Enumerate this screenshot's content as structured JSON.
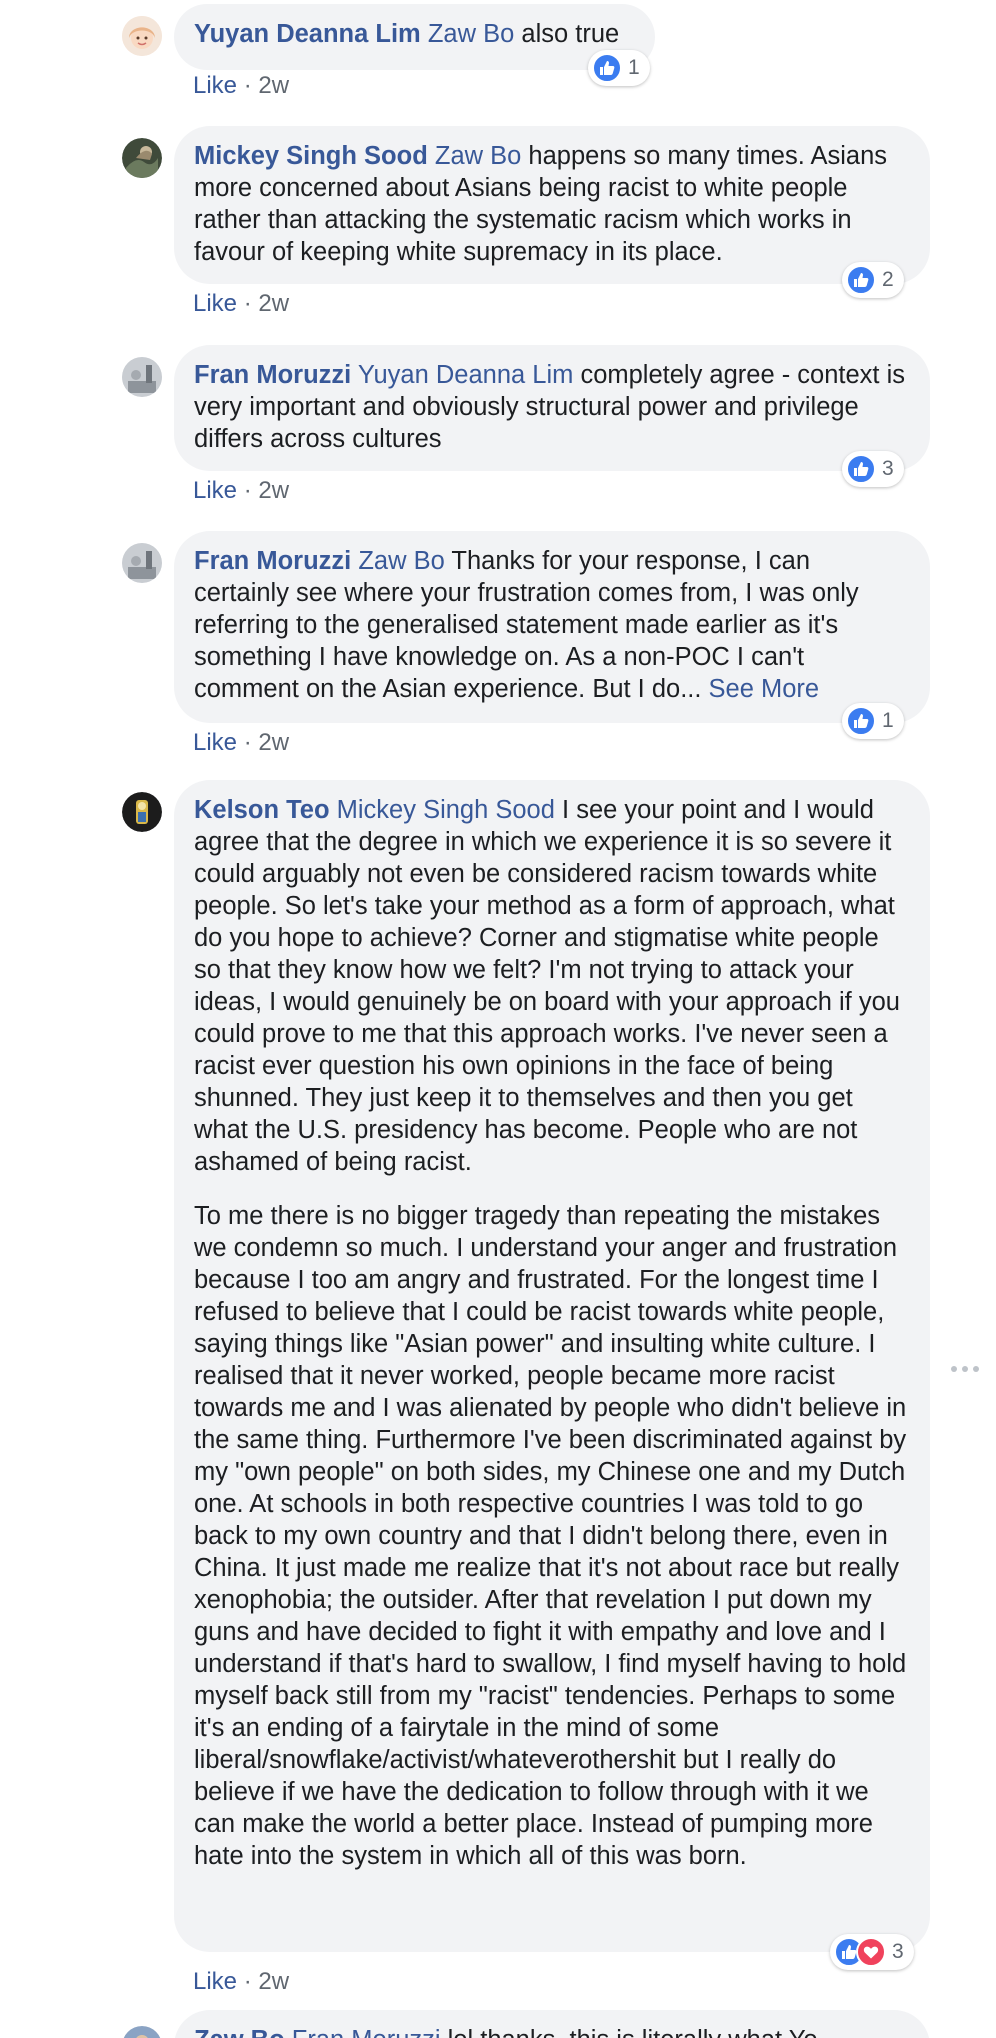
{
  "comments": [
    {
      "author": "Yuyan Deanna Lim",
      "mention": "Zaw Bo",
      "paragraphs": [
        " also true"
      ],
      "like_label": "Like",
      "sep": " · ",
      "time": "2w",
      "reaction_count": "1",
      "reactions": [
        "like"
      ]
    },
    {
      "author": "Mickey Singh Sood",
      "mention": "Zaw Bo",
      "paragraphs": [
        " happens so many times. Asians more concerned about Asians being racist to white people rather than attacking the systematic racism which works in favour of keeping white supremacy in its place."
      ],
      "like_label": "Like",
      "sep": " · ",
      "time": "2w",
      "reaction_count": "2",
      "reactions": [
        "like"
      ]
    },
    {
      "author": "Fran Moruzzi",
      "mention": "Yuyan Deanna Lim",
      "paragraphs": [
        " completely agree - context is very important and obviously structural power and privilege differs across cultures"
      ],
      "like_label": "Like",
      "sep": " · ",
      "time": "2w",
      "reaction_count": "3",
      "reactions": [
        "like"
      ]
    },
    {
      "author": "Fran Moruzzi",
      "mention": "Zaw Bo",
      "paragraphs": [
        " Thanks for your response, I can certainly see where your frustration comes from, I was only referring to the generalised statement made earlier as it's something I have knowledge on. As a non-POC I can't comment on the Asian experience. But I do... "
      ],
      "see_more": "See More",
      "like_label": "Like",
      "sep": " · ",
      "time": "2w",
      "reaction_count": "1",
      "reactions": [
        "like"
      ]
    },
    {
      "author": "Kelson Teo",
      "mention": "Mickey Singh Sood",
      "paragraphs": [
        " I see your point and I would agree that the degree in which we experience it is so severe it could arguably not even be considered racism towards white people. So let's take your method as a form of approach, what do you hope to achieve? Corner and stigmatise white people so that they know how we felt? I'm not trying to attack your ideas, I would genuinely be on board with your approach if you could prove to me that this approach works. I've never seen a racist ever question his own opinions in the face of being shunned. They just keep it to themselves and then you get what the U.S. presidency has become. People who are not ashamed of being racist.",
        "To me there is no bigger tragedy than repeating the mistakes we condemn so much. I understand your anger and frustration because I too am angry and frustrated. For the longest time I refused to believe that I could be racist towards white people, saying things like \"Asian power\" and insulting white culture. I realised that it never worked, people became more racist towards me and I was alienated by people who didn't believe in the same thing. Furthermore I've been discriminated against by my \"own people\" on both sides, my Chinese one and my Dutch one. At schools in both respective countries I was told to go back to my own country and that I didn't belong there, even in China. It just made me realize that it's not about race but really xenophobia; the outsider. After that revelation I put down my guns and have decided to fight it with empathy and love and I understand if that's hard to swallow, I find myself having to hold myself back still from my \"racist\" tendencies. Perhaps to some it's an ending of a fairytale in the mind of some liberal/snowflake/activist/whateverothershit but I really do believe if we have the dedication to follow through with it we can make the world a better place. Instead of pumping more hate into the system in which all of this was born."
      ],
      "like_label": "Like",
      "sep": " · ",
      "time": "2w",
      "reaction_count": "3",
      "reactions": [
        "like",
        "love"
      ]
    },
    {
      "author": "Zaw Bo",
      "mention": "Fran Moruzzi",
      "paragraphs": [
        " lol thanks, this is literally what Yo"
      ]
    }
  ],
  "icons": {
    "like": "thumbs-up-icon",
    "love": "heart-icon",
    "more": "more-options-icon"
  },
  "colors": {
    "link": "#385898",
    "bubble": "#f2f3f5",
    "like_reaction": "#3b7cf0",
    "love_reaction": "#f0425c",
    "meta": "#606770"
  }
}
